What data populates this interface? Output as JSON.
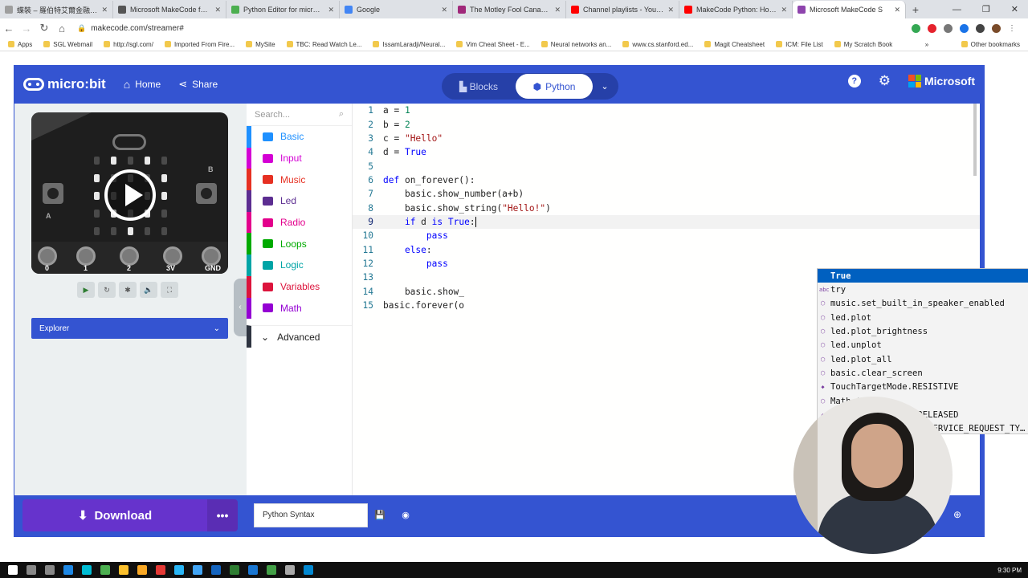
{
  "browser": {
    "tabs": [
      {
        "title": "蝶裝 – 羅伯特艾爾金融學院",
        "color": "#9e9e9e",
        "active": false
      },
      {
        "title": "Microsoft MakeCode for micro",
        "color": "#555555",
        "active": false
      },
      {
        "title": "Python Editor for micro:bit",
        "color": "#4caf50",
        "active": false
      },
      {
        "title": "Google",
        "color": "#4285f4",
        "active": false
      },
      {
        "title": "The Motley Fool Canada: St",
        "color": "#a0287a",
        "active": false
      },
      {
        "title": "Channel playlists - YouTube",
        "color": "#ff0000",
        "active": false
      },
      {
        "title": "MakeCode Python: How to",
        "color": "#ff0000",
        "active": false
      },
      {
        "title": "Microsoft MakeCode S",
        "color": "#8e44ad",
        "active": true
      }
    ],
    "new_tab": "+",
    "url": "makecode.com/streamer#",
    "bookmarks": [
      "Apps",
      "SGL Webmail",
      "http://sgl.com/",
      "Imported From Fire...",
      "MySite",
      "TBC: Read Watch Le...",
      "IssamLaradji/Neural...",
      "Vim Cheat Sheet - E...",
      "Neural networks an...",
      "www.cs.stanford.ed...",
      "Magit Cheatsheet",
      "ICM: File List",
      "My Scratch Book"
    ],
    "bookmarks_more": "»",
    "other_bookmarks": "Other bookmarks"
  },
  "app": {
    "logo": "micro:bit",
    "home": "Home",
    "share": "Share",
    "mode_blocks": "Blocks",
    "mode_python": "Python",
    "help": "?",
    "brand": "Microsoft"
  },
  "simulator": {
    "pins": [
      "0",
      "1",
      "2",
      "3V",
      "GND"
    ],
    "button_a": "A",
    "button_b": "B",
    "explorer": "Explorer"
  },
  "toolbox": {
    "search_placeholder": "Search...",
    "categories": [
      {
        "label": "Basic",
        "color": "#1e90ff"
      },
      {
        "label": "Input",
        "color": "#d400d4"
      },
      {
        "label": "Music",
        "color": "#e63022"
      },
      {
        "label": "Led",
        "color": "#5c2d91"
      },
      {
        "label": "Radio",
        "color": "#e3008c"
      },
      {
        "label": "Loops",
        "color": "#00aa00"
      },
      {
        "label": "Logic",
        "color": "#00a4a6"
      },
      {
        "label": "Variables",
        "color": "#dc143c"
      },
      {
        "label": "Math",
        "color": "#9400d3"
      }
    ],
    "advanced": "Advanced"
  },
  "editor": {
    "lines": [
      "a = 1",
      "b = 2",
      "c = \"Hello\"",
      "d = True",
      "",
      "def on_forever():",
      "    basic.show_number(a+b)",
      "    basic.show_string(\"Hello!\")",
      "    if d is True:",
      "        pass",
      "    else:",
      "        pass",
      "",
      "    basic.show_",
      "basic.forever(o"
    ],
    "suggestions": [
      "True",
      "try",
      "music.set_built_in_speaker_enabled",
      "led.plot",
      "led.plot_brightness",
      "led.unplot",
      "led.plot_all",
      "basic.clear_screen",
      "TouchTargetMode.RESISTIVE",
      "Math.tan",
      "TouchButtonEvent.RELEASED",
      "DAL.JD_CONTROL_RNG_SERVICE_REQUEST_TY…"
    ]
  },
  "footer": {
    "download": "Download",
    "more": "•••",
    "project_name": "Python Syntax"
  },
  "taskbar": {
    "clock": "9:30 PM"
  }
}
